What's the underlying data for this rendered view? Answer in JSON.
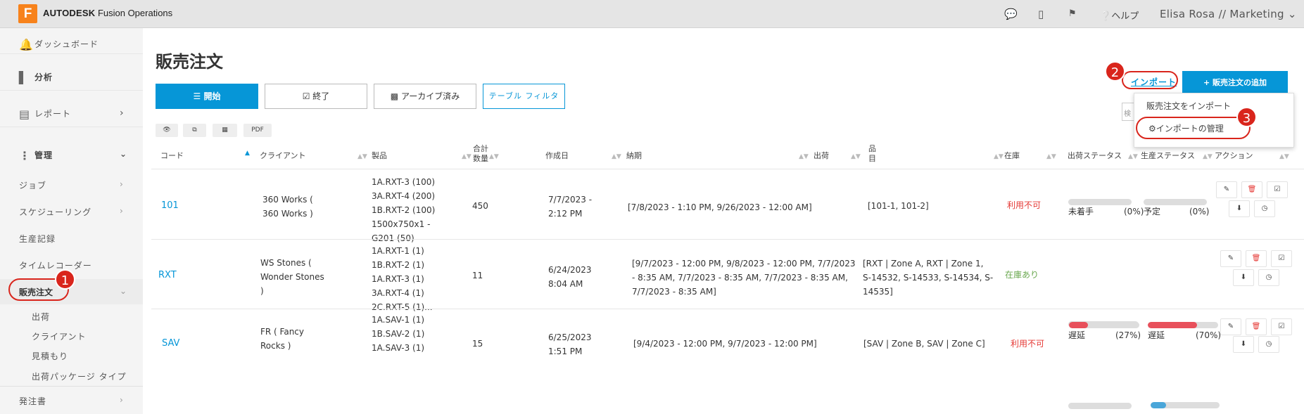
{
  "header": {
    "logo_letter": "F",
    "brand_bold": "AUTODESK",
    "brand": "Fusion Operations",
    "help": "ヘルプ",
    "user": "Elisa Rosa // Marketing"
  },
  "sidebar": {
    "dashboard": "ダッシュボード",
    "analytics": "分析",
    "reports": "レポート",
    "management": "管理",
    "jobs": "ジョブ",
    "scheduling": "スケジューリング",
    "production_records": "生産記録",
    "time_recorder": "タイムレコーダー",
    "sales_orders": "販売注文",
    "sub": [
      "出荷",
      "クライアント",
      "見積もり",
      "出荷パッケージ タイプ"
    ],
    "purchase_orders": "発注書"
  },
  "page": {
    "title": "販売注文",
    "btn_open": "開始",
    "btn_closed": "終了",
    "btn_archived": "アーカイブ済み",
    "btn_filter": "テーブル フィルタ",
    "btn_pdf": "PDF",
    "import": "インポート",
    "add": "販売注文の追加",
    "menu_import": "販売注文をインポート",
    "menu_manage": "インポートの管理",
    "search_stub": "検"
  },
  "badges": [
    "1",
    "2",
    "3"
  ],
  "columns": {
    "code": "コード",
    "client": "クライアント",
    "product": "製品",
    "total_a": "合計",
    "total_b": "数量",
    "created": "作成日",
    "due": "納期",
    "shipping": "出荷",
    "items_a": "品",
    "items_b": "目",
    "stock": "在庫",
    "ship_status": "出荷ステータス",
    "prod_status": "生産ステータス",
    "actions": "アクション"
  },
  "rows": [
    {
      "code": "101",
      "client": [
        "360 Works (",
        "360 Works )"
      ],
      "products": [
        "1A.RXT-3 (100)",
        "3A.RXT-4 (200)",
        "1B.RXT-2 (100)",
        "1500x750x1 -",
        "G201 (50)"
      ],
      "total": "450",
      "created": [
        "7/7/2023 -",
        "2:12 PM"
      ],
      "due": [
        "[7/8/2023 - 1:10 PM, 9/26/2023 - 12:00 AM]"
      ],
      "items": [
        "[101-1, 101-2]"
      ],
      "stock": "利用不可",
      "ship_label": "未着手",
      "ship_pct": "(0%)",
      "ship_val": 0,
      "prod_label": "予定",
      "prod_pct": "(0%)",
      "prod_val": 0
    },
    {
      "code": "RXT",
      "client": [
        "WS Stones (",
        "Wonder Stones",
        ")"
      ],
      "products": [
        "1A.RXT-1 (1)",
        "1B.RXT-2 (1)",
        "1A.RXT-3 (1)",
        "3A.RXT-4 (1)",
        "2C.RXT-5 (1)..."
      ],
      "total": "11",
      "created": [
        "6/24/2023",
        "8:04 AM"
      ],
      "due": [
        "[9/7/2023 - 12:00 PM, 9/8/2023 - 12:00 PM, 7/7/2023",
        "- 8:35 AM, 7/7/2023 - 8:35 AM, 7/7/2023 - 8:35 AM,",
        "7/7/2023 - 8:35 AM]"
      ],
      "items": [
        "[RXT | Zone A, RXT | Zone 1,",
        "S-14532, S-14533, S-14534, S-",
        "14535]"
      ],
      "stock": "在庫あり",
      "ship_label": "遅延",
      "ship_pct": "(27%)",
      "ship_val": 27,
      "prod_label": "遅延",
      "prod_pct": "(70%)",
      "prod_val": 70
    },
    {
      "code": "SAV",
      "client": [
        "FR ( Fancy",
        "Rocks )"
      ],
      "products": [
        "1A.SAV-1 (1)",
        "1B.SAV-2 (1)",
        "1A.SAV-3 (1)"
      ],
      "total": "15",
      "created": [
        "6/25/2023",
        "1:51 PM"
      ],
      "due": [
        "[9/4/2023 - 12:00 PM, 9/7/2023 - 12:00 PM]"
      ],
      "items": [
        "[SAV | Zone B, SAV | Zone C]"
      ],
      "stock": "利用不可",
      "ship_label": "",
      "ship_pct": "",
      "ship_val": 0,
      "prod_label": "",
      "prod_pct": "",
      "prod_val": 0
    }
  ],
  "colors": {
    "accent": "#0696d7",
    "alert": "#d9251c",
    "bar_red": "#e8505b",
    "bar_blue": "#4aa6d9"
  }
}
